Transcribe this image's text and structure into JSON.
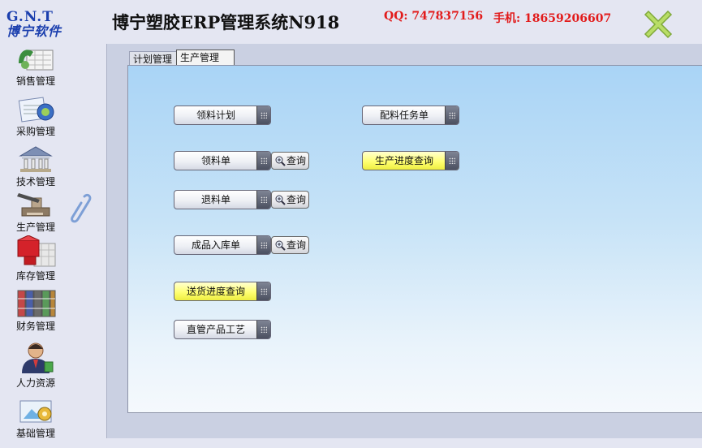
{
  "header": {
    "logo_top": "G.N.T",
    "logo_bottom": "博宁软件",
    "title": "博宁塑胶ERP管理系统N918",
    "qq": "QQ: 747837156",
    "phone": "手机: 18659206607"
  },
  "sidebar": {
    "items": [
      {
        "label": "销售管理",
        "icon": "sales-icon"
      },
      {
        "label": "采购管理",
        "icon": "purchase-icon"
      },
      {
        "label": "技术管理",
        "icon": "tech-icon"
      },
      {
        "label": "生产管理",
        "icon": "production-icon"
      },
      {
        "label": "库存管理",
        "icon": "inventory-icon"
      },
      {
        "label": "财务管理",
        "icon": "finance-icon"
      },
      {
        "label": "人力资源",
        "icon": "hr-icon"
      },
      {
        "label": "基础管理",
        "icon": "base-icon"
      }
    ]
  },
  "tabs": [
    {
      "label": "计划管理",
      "active": false
    },
    {
      "label": "生产管理",
      "active": true
    }
  ],
  "buttons": {
    "material_plan": "领料计划",
    "material_slip": "领料单",
    "return_slip": "退料单",
    "product_inbound": "成品入库单",
    "delivery_progress": "送货进度查询",
    "direct_product_process": "直管产品工艺",
    "batching_task": "配料任务单",
    "production_progress": "生产进度查询",
    "query": "查询"
  },
  "colors": {
    "accent_yellow": "#ffff73",
    "header_red": "#e21b1b",
    "logo_blue": "#1b3fae"
  }
}
